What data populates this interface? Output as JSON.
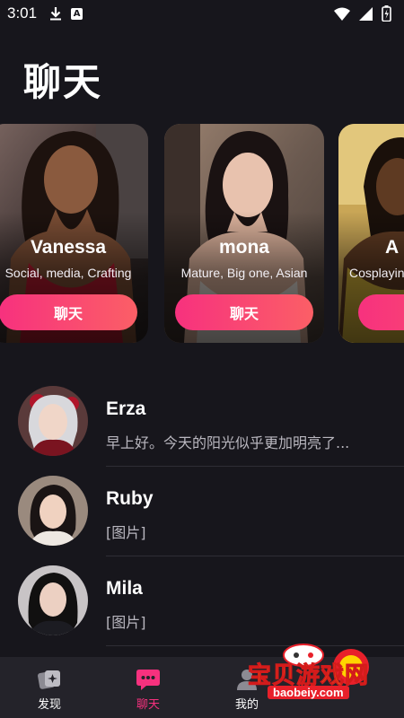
{
  "status_bar": {
    "time": "3:01",
    "icons": [
      "download-icon",
      "a-notification-icon",
      "wifi-icon",
      "signal-icon",
      "battery-icon"
    ]
  },
  "page": {
    "title": "聊天"
  },
  "cards": [
    {
      "name": "Vanessa",
      "tags": "Social, media, Crafting",
      "button": "聊天"
    },
    {
      "name": "mona",
      "tags": "Mature, Big one, Asian",
      "button": "聊天"
    },
    {
      "name": "A",
      "tags": "Cosplayin",
      "button": ""
    }
  ],
  "chats": [
    {
      "name": "Erza",
      "message": "早上好。今天的阳光似乎更加明亮了..."
    },
    {
      "name": "Ruby",
      "message": "[图片]"
    },
    {
      "name": "Mila",
      "message": "[图片]"
    }
  ],
  "tabs": [
    {
      "label": "发现",
      "icon": "discover-icon",
      "active": false
    },
    {
      "label": "聊天",
      "icon": "chat-bubble-icon",
      "active": true
    },
    {
      "label": "我的",
      "icon": "profile-icon",
      "active": false
    }
  ],
  "watermark": {
    "title": "宝贝游戏网",
    "url": "baobeiy.com"
  },
  "colors": {
    "background": "#17161c",
    "accent": "#f7317e",
    "tab_bar": "#24232a"
  }
}
